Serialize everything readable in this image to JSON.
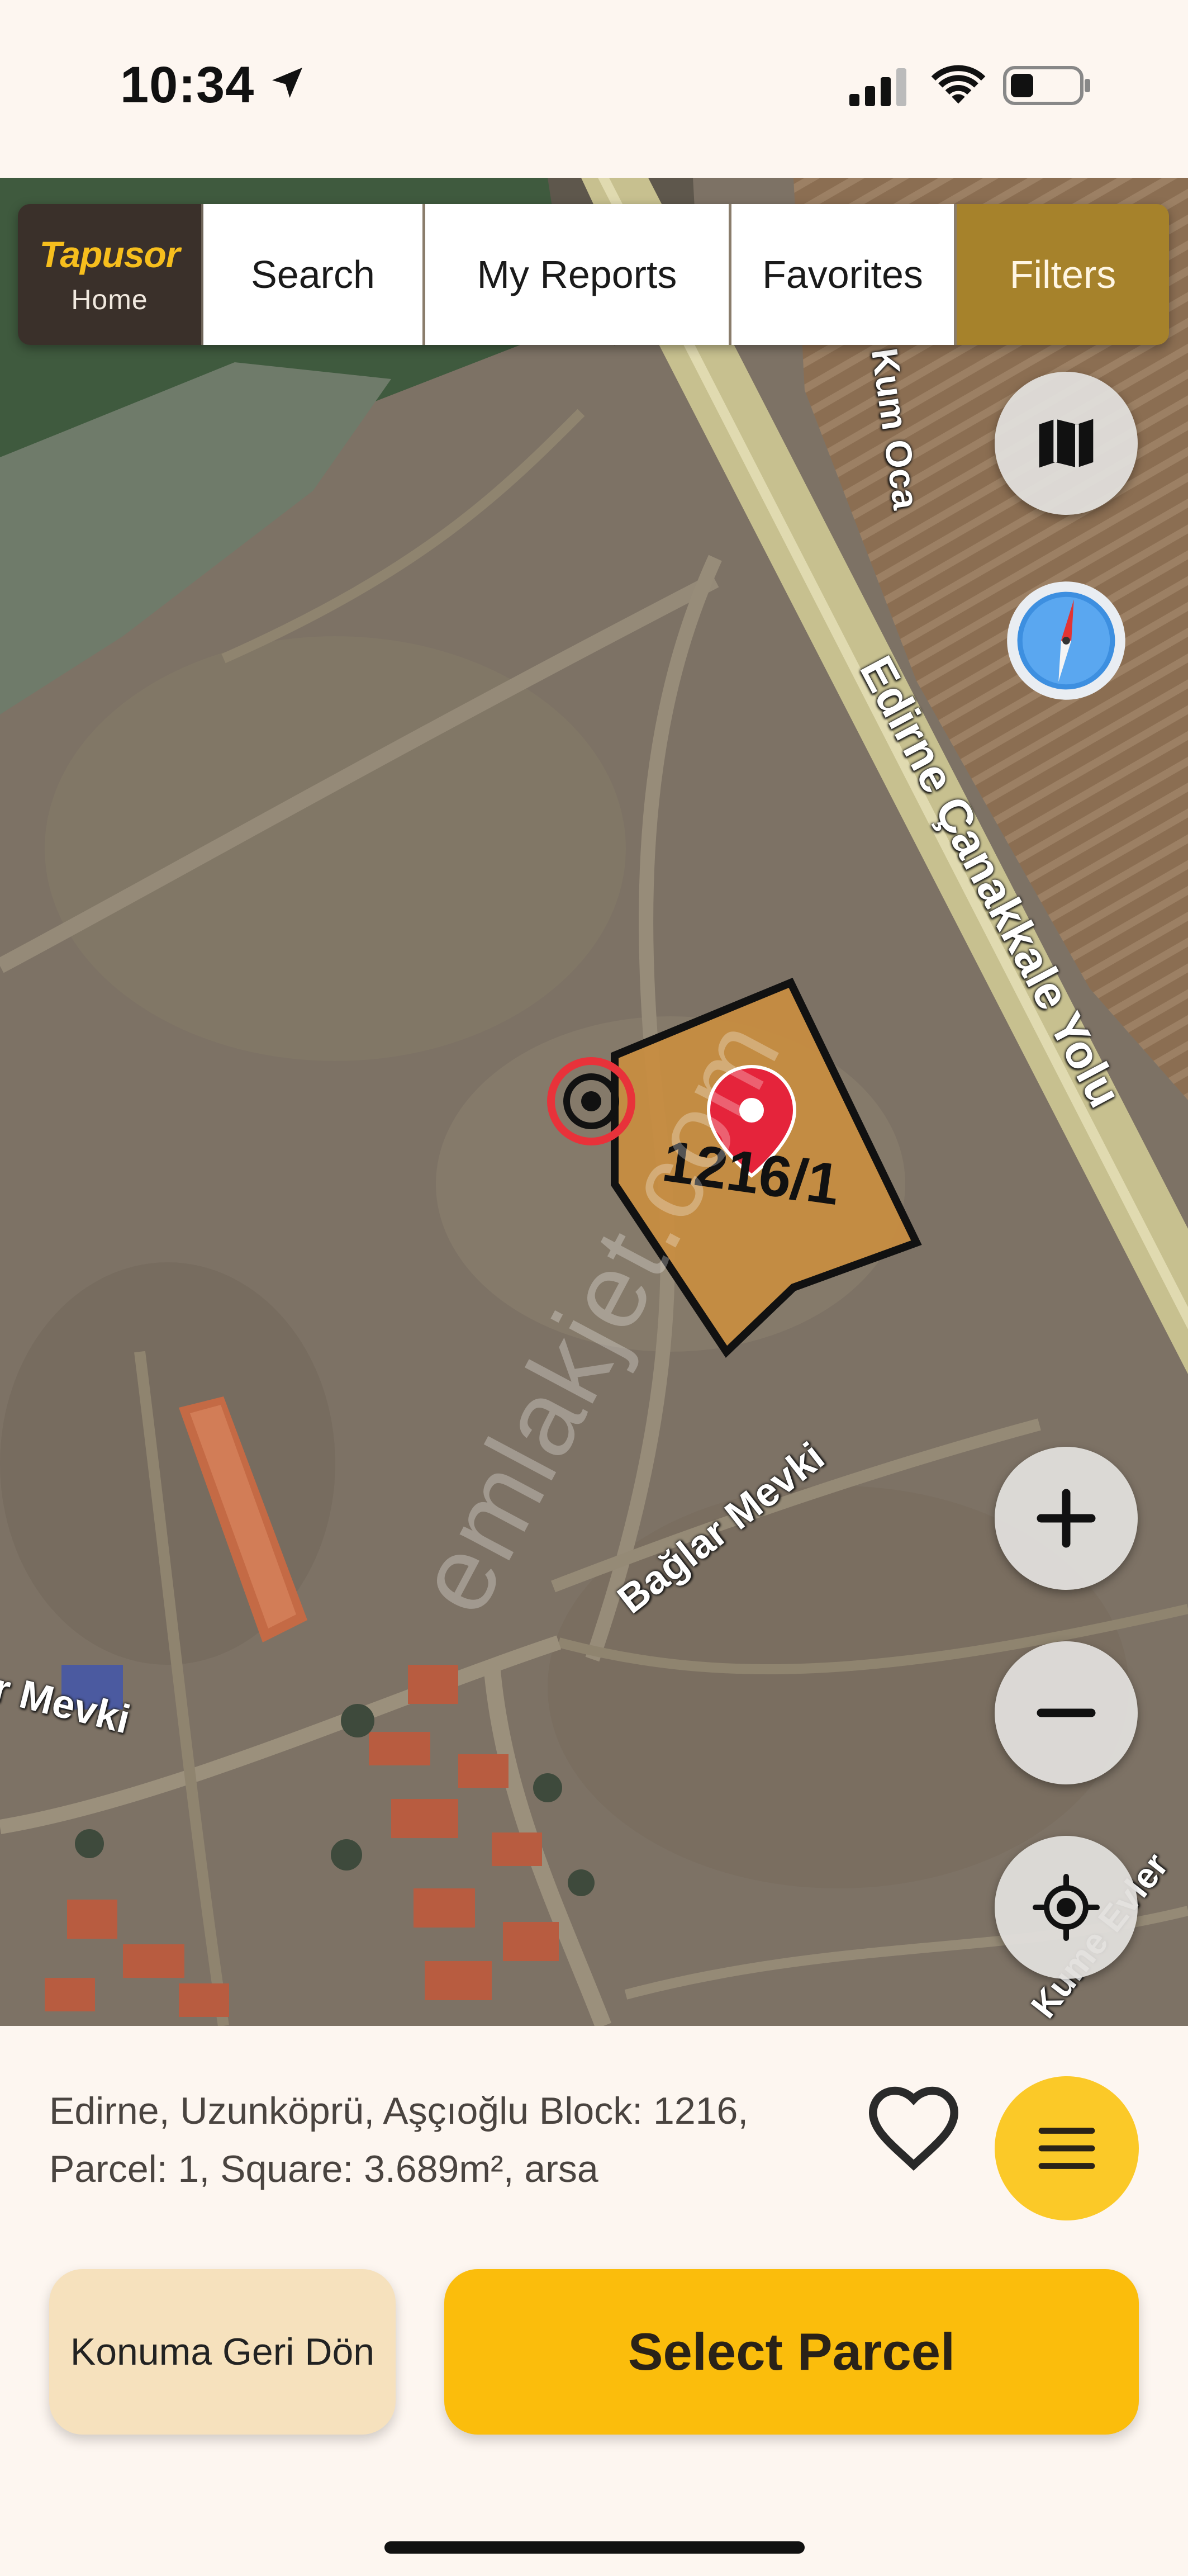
{
  "status_bar": {
    "time": "10:34"
  },
  "nav": {
    "brand": "Tapusor",
    "home_label": "Home",
    "tabs": [
      {
        "label": "Search"
      },
      {
        "label": "My Reports"
      },
      {
        "label": "Favorites"
      },
      {
        "label": "Filters"
      }
    ]
  },
  "map": {
    "parcel_label": "1216/1",
    "road_labels": {
      "highway": "Edirne Çanakkale Yolu",
      "kum": "Kum Oca",
      "baglar": "Bağlar Mevki",
      "left_mevki": "r Mevki",
      "right_bottom": "Kume Evler"
    },
    "watermark": "emlakjet.com",
    "controls": [
      "map-layers-icon",
      "compass-icon",
      "zoom-in-icon",
      "zoom-out-icon",
      "locate-icon"
    ]
  },
  "sheet": {
    "parcel_info": "Edirne, Uzunköprü, Aşçıoğlu Block: 1216, Parcel: 1, Square: 3.689m², arsa",
    "back_button": "Konuma Geri Dön",
    "select_button": "Select Parcel"
  },
  "colors": {
    "accent": "#fbbd0c",
    "filters_tab": "#a6822b",
    "brand": "#f6be1d",
    "parcel_fill": "#c98d40"
  }
}
